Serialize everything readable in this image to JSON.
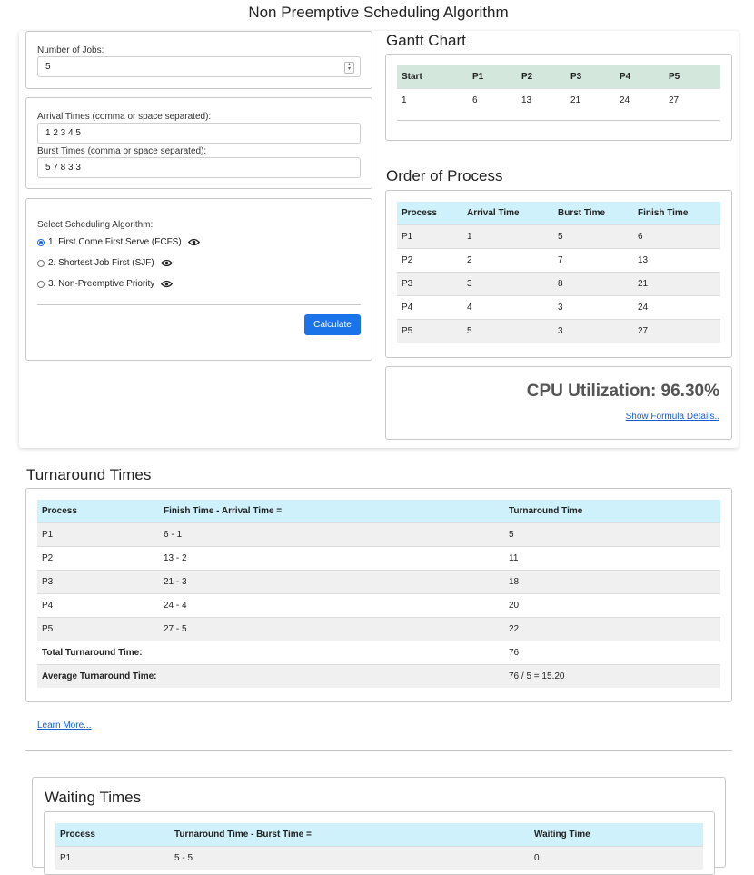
{
  "title": "Non Preemptive Scheduling Algorithm",
  "inputs": {
    "jobs_label": "Number of Jobs:",
    "jobs_value": "5",
    "arrival_label": "Arrival Times (comma or space separated):",
    "arrival_value": "1 2 3 4 5",
    "burst_label": "Burst Times (comma or space separated):",
    "burst_value": "5 7 8 3 3"
  },
  "algorithm": {
    "label": "Select Scheduling Algorithm:",
    "options": [
      {
        "label": "1. First Come First Serve (FCFS)",
        "selected": true
      },
      {
        "label": "2. Shortest Job First (SJF)",
        "selected": false
      },
      {
        "label": "3. Non-Preemptive Priority",
        "selected": false
      }
    ],
    "calculate_label": "Calculate"
  },
  "gantt": {
    "heading": "Gantt Chart",
    "headers": [
      "Start",
      "P1",
      "P2",
      "P3",
      "P4",
      "P5"
    ],
    "values": [
      "1",
      "6",
      "13",
      "21",
      "24",
      "27"
    ]
  },
  "order": {
    "heading": "Order of Process",
    "headers": [
      "Process",
      "Arrival Time",
      "Burst Time",
      "Finish Time"
    ],
    "rows": [
      [
        "P1",
        "1",
        "5",
        "6"
      ],
      [
        "P2",
        "2",
        "7",
        "13"
      ],
      [
        "P3",
        "3",
        "8",
        "21"
      ],
      [
        "P4",
        "4",
        "3",
        "24"
      ],
      [
        "P5",
        "5",
        "3",
        "27"
      ]
    ]
  },
  "cpu": {
    "text": "CPU Utilization: 96.30%",
    "link": "Show Formula Details.."
  },
  "turnaround": {
    "heading": "Turnaround Times",
    "headers": [
      "Process",
      "Finish Time - Arrival Time =",
      "Turnaround Time"
    ],
    "rows": [
      [
        "P1",
        "6 - 1",
        "5"
      ],
      [
        "P2",
        "13 - 2",
        "11"
      ],
      [
        "P3",
        "21 - 3",
        "18"
      ],
      [
        "P4",
        "24 - 4",
        "20"
      ],
      [
        "P5",
        "27 - 5",
        "22"
      ]
    ],
    "total_label": "Total Turnaround Time:",
    "total_value": "76",
    "avg_label": "Average Turnaround Time:",
    "avg_value": "76 / 5 = 15.20",
    "learn_more": "Learn More..."
  },
  "waiting": {
    "heading": "Waiting Times",
    "headers": [
      "Process",
      "Turnaround Time - Burst Time =",
      "Waiting Time"
    ],
    "first_row": [
      "P1",
      "5 - 5",
      "0"
    ]
  },
  "colors": {
    "accent": "#1a73e8",
    "gantt_header": "#d4e7dc",
    "table_header": "#cff1fb"
  },
  "icons": {
    "eye": "eye-icon"
  }
}
